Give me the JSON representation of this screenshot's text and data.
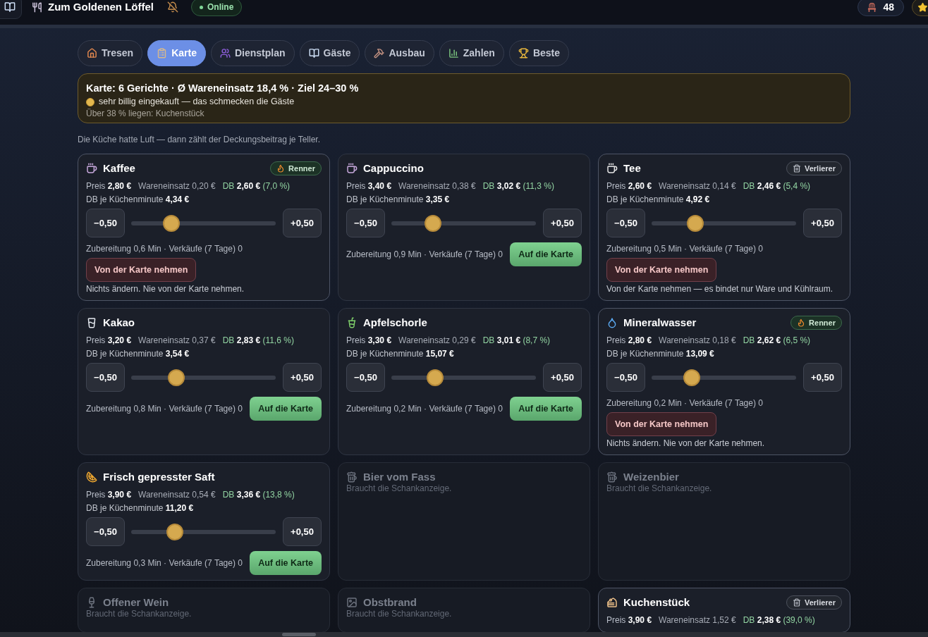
{
  "header": {
    "title": "Zum Goldenen Löffel",
    "status": "Online",
    "seats": "48"
  },
  "tabs": [
    {
      "label": "Tresen",
      "selected": false
    },
    {
      "label": "Karte",
      "selected": true
    },
    {
      "label": "Dienstplan",
      "selected": false
    },
    {
      "label": "Gäste",
      "selected": false
    },
    {
      "label": "Ausbau",
      "selected": false
    },
    {
      "label": "Zahlen",
      "selected": false
    },
    {
      "label": "Beste",
      "selected": false
    }
  ],
  "summary": {
    "title": "Karte: 6 Gerichte · Ø Wareneinsatz 18,4 % · Ziel 24–30 %",
    "verdict": "sehr billig eingekauft — das schmecken die Gäste",
    "outliers": "Über 38 % liegen: Kuchenstück"
  },
  "note": "Die Küche hatte Luft — dann zählt der Deckungsbeitrag je Teller.",
  "dishes": [
    {
      "kind": "dish",
      "name": "Kaffee",
      "on_menu": true,
      "badge": {
        "kind": "hot",
        "label": "Renner"
      },
      "price": "Preis **2,80 €**",
      "cost": "Wareneinsatz 0,20 €",
      "margin": "DB **2,60 €** (7,0 %)",
      "per_minute": "DB je Küchenminute **4,34 €**",
      "minus": "−0,50",
      "plus": "+0,50",
      "level": 0.28,
      "details": "Zubereitung 0,6 Min · Verkäufe (7 Tage) 0",
      "action": "Von der Karte nehmen",
      "advice": "Nichts ändern. Nie von der Karte nehmen."
    },
    {
      "kind": "dish",
      "name": "Cappuccino",
      "on_menu": false,
      "price": "Preis **3,40 €**",
      "cost": "Wareneinsatz 0,38 €",
      "margin": "DB **3,02 €** (11,3 %)",
      "per_minute": "DB je Küchenminute **3,35 €**",
      "minus": "−0,50",
      "plus": "+0,50",
      "level": 0.29,
      "details": "Zubereitung 0,9 Min · Verkäufe (7 Tage) 0",
      "action": "Auf die Karte"
    },
    {
      "kind": "dish",
      "name": "Tee",
      "on_menu": true,
      "badge": {
        "kind": "loser",
        "label": "Verlierer"
      },
      "price": "Preis **2,60 €**",
      "cost": "Wareneinsatz 0,14 €",
      "margin": "DB **2,46 €** (5,4 %)",
      "per_minute": "DB je Küchenminute **4,92 €**",
      "minus": "−0,50",
      "plus": "+0,50",
      "level": 0.3,
      "details": "Zubereitung 0,5 Min · Verkäufe (7 Tage) 0",
      "action": "Von der Karte nehmen",
      "advice": "Von der Karte nehmen — es bindet nur Ware und Kühlraum."
    },
    {
      "kind": "dish",
      "name": "Kakao",
      "on_menu": false,
      "price": "Preis **3,20 €**",
      "cost": "Wareneinsatz 0,37 €",
      "margin": "DB **2,83 €** (11,6 %)",
      "per_minute": "DB je Küchenminute **3,54 €**",
      "minus": "−0,50",
      "plus": "+0,50",
      "level": 0.31,
      "details": "Zubereitung 0,8 Min · Verkäufe (7 Tage) 0",
      "action": "Auf die Karte"
    },
    {
      "kind": "dish",
      "name": "Apfelschorle",
      "on_menu": false,
      "price": "Preis **3,30 €**",
      "cost": "Wareneinsatz 0,29 €",
      "margin": "DB **3,01 €** (8,7 %)",
      "per_minute": "DB je Küchenminute **15,07 €**",
      "minus": "−0,50",
      "plus": "+0,50",
      "level": 0.3,
      "details": "Zubereitung 0,2 Min · Verkäufe (7 Tage) 0",
      "action": "Auf die Karte"
    },
    {
      "kind": "dish",
      "name": "Mineralwasser",
      "on_menu": true,
      "badge": {
        "kind": "hot",
        "label": "Renner"
      },
      "price": "Preis **2,80 €**",
      "cost": "Wareneinsatz 0,18 €",
      "margin": "DB **2,62 €** (6,5 %)",
      "per_minute": "DB je Küchenminute **13,09 €**",
      "minus": "−0,50",
      "plus": "+0,50",
      "level": 0.28,
      "details": "Zubereitung 0,2 Min · Verkäufe (7 Tage) 0",
      "action": "Von der Karte nehmen",
      "advice": "Nichts ändern. Nie von der Karte nehmen."
    },
    {
      "kind": "dish",
      "name": "Frisch gepresster Saft",
      "on_menu": false,
      "price": "Preis **3,90 €**",
      "cost": "Wareneinsatz 0,54 €",
      "margin": "DB **3,36 €** (13,8 %)",
      "per_minute": "DB je Küchenminute **11,20 €**",
      "minus": "−0,50",
      "plus": "+0,50",
      "level": 0.3,
      "details": "Zubereitung 0,3 Min · Verkäufe (7 Tage) 0",
      "action": "Auf die Karte"
    },
    {
      "kind": "locked",
      "name": "Bier vom Fass",
      "hint": "Braucht die Schankanzeige."
    },
    {
      "kind": "locked",
      "name": "Weizenbier",
      "hint": "Braucht die Schankanzeige."
    },
    {
      "kind": "locked",
      "name": "Offener Wein",
      "hint": "Braucht die Schankanzeige."
    },
    {
      "kind": "locked",
      "name": "Obstbrand",
      "hint": "Braucht die Schankanzeige."
    },
    {
      "kind": "dish",
      "name": "Kuchenstück",
      "on_menu": true,
      "badge": {
        "kind": "loser",
        "label": "Verlierer"
      },
      "price": "Preis **3,90 €**",
      "cost": "Wareneinsatz 1,52 €",
      "margin": "DB **2,38 €** (39,0 %)"
    }
  ]
}
